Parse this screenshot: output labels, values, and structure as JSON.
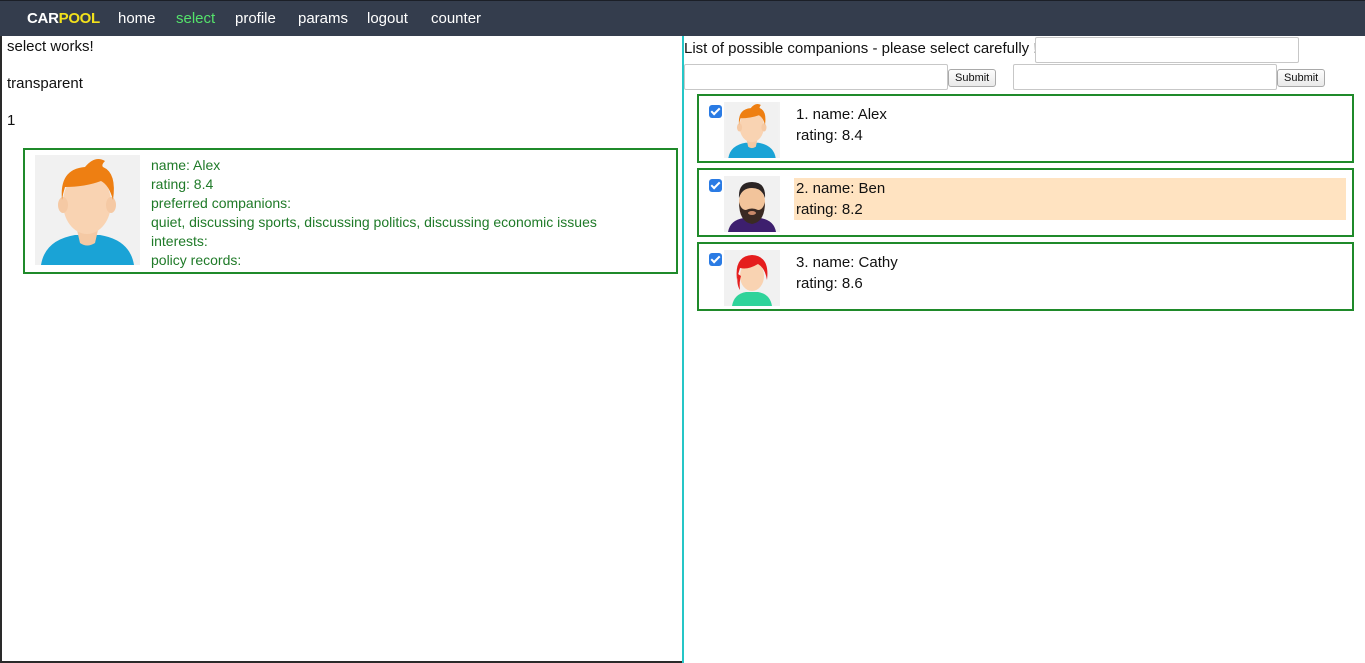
{
  "nav": {
    "brand_part1": "CAR",
    "brand_part2": "POOL",
    "links": [
      "home",
      "select",
      "profile",
      "params",
      "logout",
      "counter"
    ],
    "active": "select"
  },
  "left": {
    "line1": "select works!",
    "line2": "transparent",
    "line3": "1",
    "detail": {
      "name": "name: Alex",
      "rating": "rating: 8.4",
      "preferred_label": "preferred companions:",
      "preferred_values": "quiet, discussing sports, discussing politics, discussing economic issues",
      "interests": "interests:",
      "policy": "policy records:"
    }
  },
  "right": {
    "title": "List of possible companions - please select carefully !",
    "input1_value": "",
    "input2_value": "",
    "input3_value": "",
    "submit1": "Submit",
    "submit2": "Submit",
    "companions": [
      {
        "name": "1. name: Alex",
        "rating": "rating: 8.4",
        "checked": true
      },
      {
        "name": "2. name: Ben",
        "rating": "rating: 8.2",
        "checked": true
      },
      {
        "name": "3. name: Cathy",
        "rating": "rating: 8.6",
        "checked": true
      }
    ]
  },
  "colors": {
    "navbar": "#343d4d",
    "brand_accent": "#f2e11c",
    "active_link": "#54e26b",
    "card_border": "#1f8a2a",
    "divider": "#25c6c7",
    "highlight": "#ffe3c1"
  },
  "icons": {
    "alex_avatar": "man-orange-hair-avatar",
    "ben_avatar": "bearded-man-avatar",
    "cathy_avatar": "woman-red-hair-avatar"
  }
}
